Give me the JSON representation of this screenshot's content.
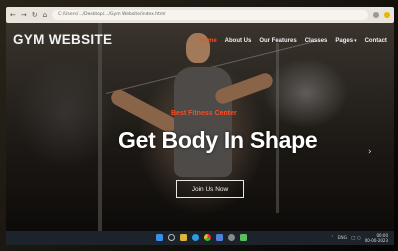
{
  "browser": {
    "back_icon": "←",
    "forward_icon": "→",
    "reload_icon": "↻",
    "home_icon": "⌂",
    "url": "C:/Users/.../Desktop/.../Gym Website/index.html"
  },
  "site": {
    "logo": "GYM WEBSITE",
    "nav": {
      "home": "Home",
      "about": "About Us",
      "features": "Our Features",
      "classes": "Classes",
      "pages": "Pages",
      "pages_caret": "▾",
      "contact": "Contact"
    },
    "hero": {
      "subtitle": "Best Fitness Center",
      "title": "Get Body In Shape",
      "button": "Join Us Now",
      "next_arrow": "›"
    },
    "colors": {
      "accent": "#ff4a1f",
      "text": "#ffffff"
    }
  },
  "taskbar": {
    "tray_chevron": "˄",
    "tray_lang": "ENG",
    "tray_icons": "□ ○",
    "time": "00:00",
    "date": "00-00-2023"
  }
}
